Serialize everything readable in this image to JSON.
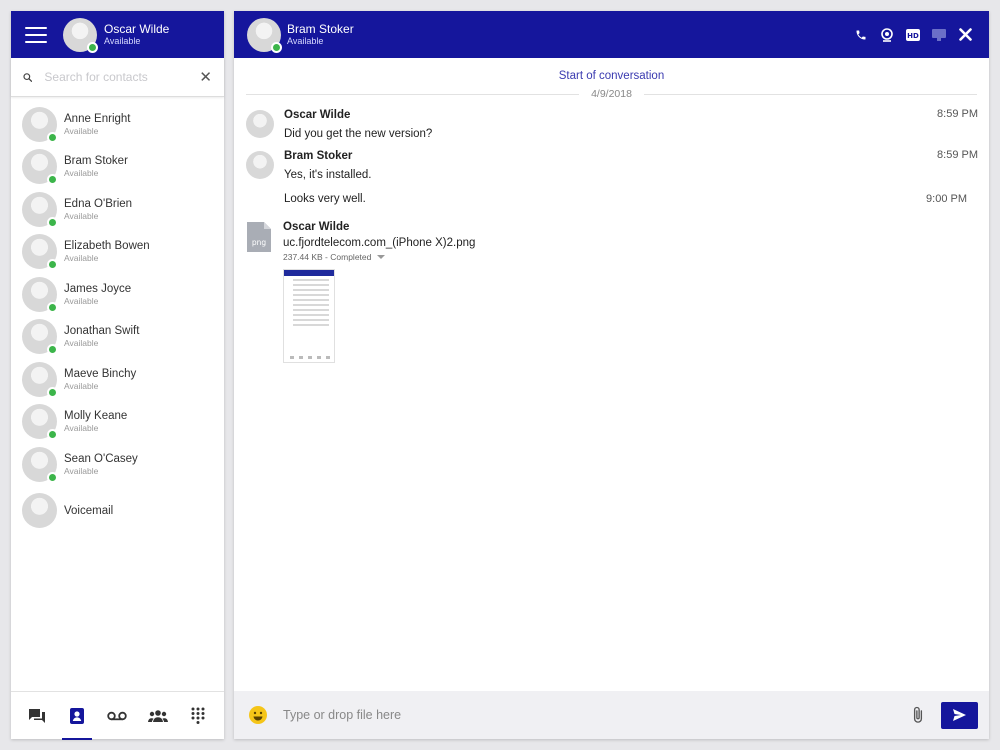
{
  "colors": {
    "header": "#15169c",
    "online": "#3cb54a",
    "link": "#3a3ab0"
  },
  "me": {
    "name": "Oscar Wilde",
    "status": "Available"
  },
  "search": {
    "placeholder": "Search for contacts"
  },
  "contacts": [
    {
      "name": "Anne Enright",
      "status": "Available"
    },
    {
      "name": "Bram Stoker",
      "status": "Available"
    },
    {
      "name": "Edna O'Brien",
      "status": "Available"
    },
    {
      "name": "Elizabeth Bowen",
      "status": "Available"
    },
    {
      "name": "James Joyce",
      "status": "Available"
    },
    {
      "name": "Jonathan Swift",
      "status": "Available"
    },
    {
      "name": "Maeve Binchy",
      "status": "Available"
    },
    {
      "name": "Molly Keane",
      "status": "Available"
    },
    {
      "name": "Sean O'Casey",
      "status": "Available"
    },
    {
      "name": "Voicemail",
      "status": ""
    }
  ],
  "bottom_tabs": [
    "chat-icon",
    "contacts-icon",
    "voicemail-icon",
    "groups-icon",
    "dialpad-icon"
  ],
  "chat": {
    "contact": {
      "name": "Bram Stoker",
      "status": "Available"
    },
    "header_icons": [
      "phone-icon",
      "webcam-icon",
      "hd-icon",
      "screen-share-icon",
      "close-icon"
    ],
    "start_label": "Start of conversation",
    "date": "4/9/2018",
    "messages": [
      {
        "sender": "Oscar Wilde",
        "text": "Did you get the new version?",
        "time": "8:59 PM"
      },
      {
        "sender": "Bram Stoker",
        "text": "Yes, it's installed.",
        "time": "8:59 PM",
        "followup": {
          "text": "Looks very well.",
          "time": "9:00 PM"
        }
      }
    ],
    "file": {
      "sender": "Oscar Wilde",
      "icon_label": "png",
      "filename": "uc.fjordtelecom.com_(iPhone X)2.png",
      "meta": "237.44 KB - Completed"
    }
  },
  "composer": {
    "placeholder": "Type or drop file here"
  }
}
